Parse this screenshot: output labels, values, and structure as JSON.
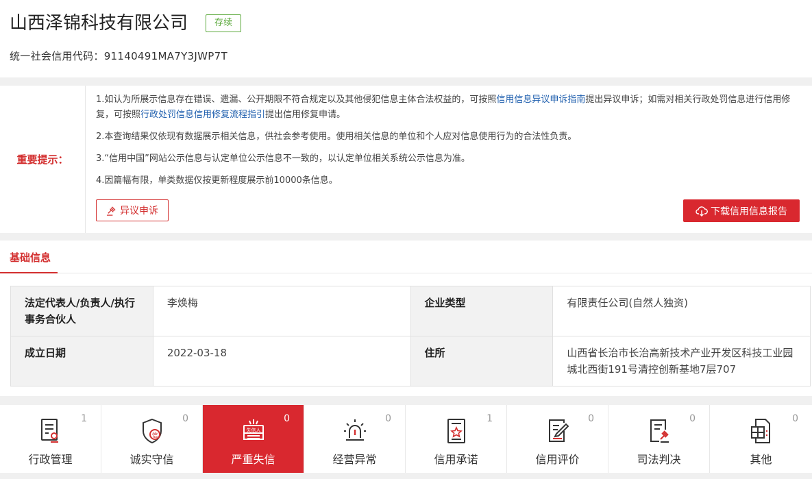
{
  "header": {
    "company_name": "山西泽锦科技有限公司",
    "status": "存续",
    "credit_code_label": "统一社会信用代码：",
    "credit_code": "91140491MA7Y3JWP7T"
  },
  "notice": {
    "label": "重要提示：",
    "item1_a": "1.如认为所展示信息存在错误、遗漏、公开期限不符合规定以及其他侵犯信息主体合法权益的，可按照",
    "item1_link1": "信用信息异议申诉指南",
    "item1_b": "提出异议申诉；如需对相关行政处罚信息进行信用修复，可按照",
    "item1_link2": "行政处罚信息信用修复流程指引",
    "item1_c": "提出信用修复申请。",
    "item2": "2.本查询结果仅依现有数据展示相关信息，供社会参考使用。使用相关信息的单位和个人应对信息使用行为的合法性负责。",
    "item3": "3.“信用中国”网站公示信息与认定单位公示信息不一致的，以认定单位相关系统公示信息为准。",
    "item4": "4.因篇幅有限，单类数据仅按更新程度展示前10000条信息。",
    "objection_button": "异议申诉",
    "download_button": "下载信用信息报告"
  },
  "basic": {
    "tab_label": "基础信息",
    "legal_rep_label": "法定代表人/负责人/执行事务合伙人",
    "legal_rep_value": "李焕梅",
    "type_label": "企业类型",
    "type_value": "有限责任公司(自然人独资)",
    "date_label": "成立日期",
    "date_value": "2022-03-18",
    "address_label": "住所",
    "address_value": "山西省长治市长治高新技术产业开发区科技工业园城北西街191号清控创新基地7层707"
  },
  "tabs": [
    {
      "label": "行政管理",
      "count": "1",
      "icon": "document-stamp-icon"
    },
    {
      "label": "诚实守信",
      "count": "0",
      "icon": "shield-credit-icon"
    },
    {
      "label": "严重失信",
      "count": "0",
      "icon": "dishonest-person-icon",
      "active": true
    },
    {
      "label": "经营异常",
      "count": "0",
      "icon": "alarm-light-icon"
    },
    {
      "label": "信用承诺",
      "count": "1",
      "icon": "star-document-icon"
    },
    {
      "label": "信用评价",
      "count": "0",
      "icon": "evaluation-edit-icon"
    },
    {
      "label": "司法判决",
      "count": "0",
      "icon": "judgment-gavel-icon"
    },
    {
      "label": "其他",
      "count": "0",
      "icon": "other-grid-icon"
    }
  ],
  "colors": {
    "accent": "#d9282f",
    "status_green": "#5aa83a",
    "link": "#1f5fae"
  }
}
